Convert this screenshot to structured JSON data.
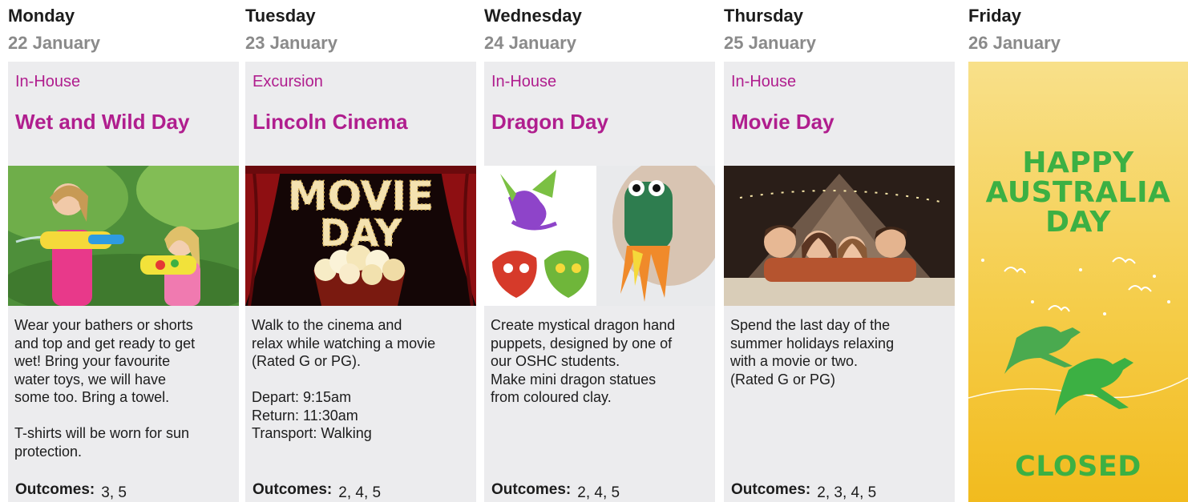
{
  "days": [
    {
      "name": "Monday",
      "date": "22 January",
      "category": "In-House",
      "title": "Wet and Wild Day",
      "description": [
        "Wear your bathers or shorts",
        "and top and get ready to get",
        "wet! Bring your favourite",
        "water toys, we will have",
        "some too. Bring a towel.",
        "",
        "T-shirts will be worn for sun",
        "protection."
      ],
      "outcomes_label": "Outcomes:",
      "outcomes": "3, 5"
    },
    {
      "name": "Tuesday",
      "date": "23 January",
      "category": "Excursion",
      "title": "Lincoln Cinema",
      "photo_text_1": "MOVIE",
      "photo_text_2": "DAY",
      "description": [
        "Walk to the cinema and",
        "relax while watching a movie",
        "(Rated G or PG).",
        "",
        "Depart: 9:15am",
        "Return: 11:30am",
        "Transport: Walking"
      ],
      "outcomes_label": "Outcomes:",
      "outcomes": "2, 4, 5"
    },
    {
      "name": "Wednesday",
      "date": "24 January",
      "category": "In-House",
      "title": "Dragon Day",
      "description": [
        "Create mystical dragon hand",
        "puppets, designed by one of",
        "our OSHC students.",
        "Make mini dragon statues",
        "from coloured clay."
      ],
      "outcomes_label": "Outcomes:",
      "outcomes": "2, 4, 5"
    },
    {
      "name": "Thursday",
      "date": "25 January",
      "category": "In-House",
      "title": "Movie Day",
      "description": [
        "Spend the last day of the",
        "summer holidays relaxing",
        "with a movie or two.",
        "(Rated G or PG)"
      ],
      "outcomes_label": "Outcomes:",
      "outcomes": "2, 3, 4, 5"
    }
  ],
  "friday": {
    "name": "Friday",
    "date": "26 January",
    "banner_lines": [
      "HAPPY",
      "AUSTRALIA",
      "DAY"
    ],
    "closed": "CLOSED"
  },
  "colors": {
    "accent": "#b01e8e",
    "card_bg": "#ececee",
    "date_gray": "#8a8a8a",
    "green": "#3cb043",
    "yellow": "#f5cd4a"
  }
}
